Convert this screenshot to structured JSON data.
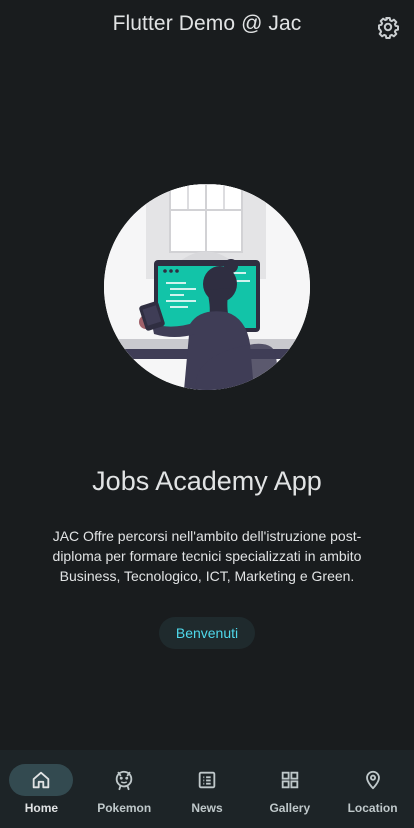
{
  "appbar": {
    "title": "Flutter Demo @ Jac",
    "settings_icon": "gear-icon"
  },
  "main": {
    "headline": "Jobs Academy App",
    "description": "JAC Offre percorsi nell'ambito dell'istruzione post-diploma per formare tecnici specializzati in ambito Business, Tecnologico, ICT, Marketing e Green.",
    "button_label": "Benvenuti"
  },
  "navbar": {
    "items": [
      {
        "label": "Home",
        "icon": "home-icon",
        "active": true
      },
      {
        "label": "Pokemon",
        "icon": "pokemon-icon",
        "active": false
      },
      {
        "label": "News",
        "icon": "news-icon",
        "active": false
      },
      {
        "label": "Gallery",
        "icon": "gallery-icon",
        "active": false
      },
      {
        "label": "Location",
        "icon": "location-pin-icon",
        "active": false
      }
    ]
  },
  "colors": {
    "background": "#191c1e",
    "accent": "#4fd8eb",
    "nav_background": "#1d2427",
    "nav_indicator": "#334a50"
  }
}
